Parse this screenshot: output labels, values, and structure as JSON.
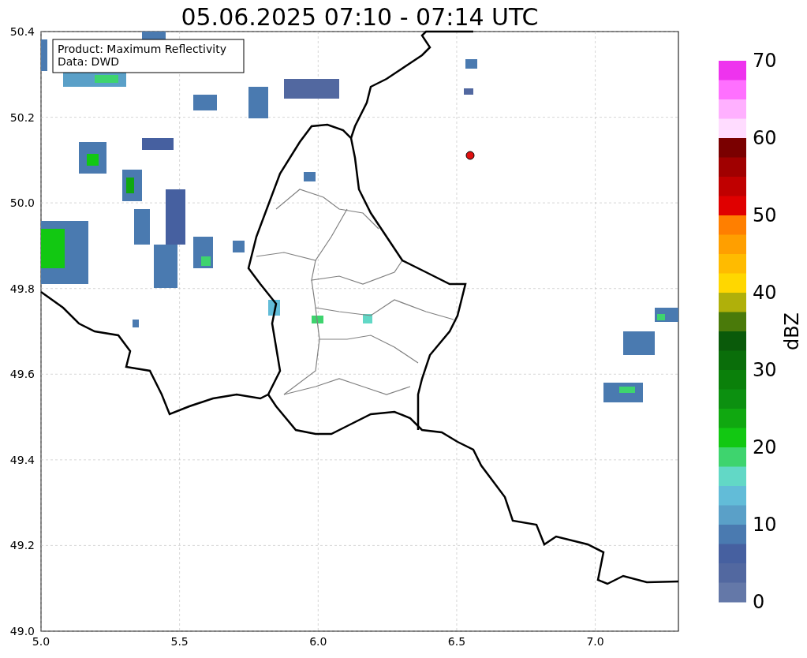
{
  "figure": {
    "title": "05.06.2025 07:10 - 07:14 UTC"
  },
  "annotation": {
    "lines": [
      "Product: Maximum Reflectivity",
      "Data: DWD"
    ]
  },
  "map": {
    "x_ticks": [
      "5.0",
      "5.5",
      "6.0",
      "6.5",
      "7.0"
    ],
    "y_ticks": [
      "50.4",
      "50.2",
      "50.0",
      "49.8",
      "49.6",
      "49.4",
      "49.2",
      "49.0"
    ]
  },
  "colorbar": {
    "label": "dBZ",
    "ticks": [
      "70",
      "60",
      "50",
      "40",
      "30",
      "20",
      "10",
      "0"
    ],
    "segments": [
      {
        "color": "#ee33ee"
      },
      {
        "color": "#ff70ff"
      },
      {
        "color": "#ffb0ff"
      },
      {
        "color": "#ffdcff"
      },
      {
        "color": "#7a0000"
      },
      {
        "color": "#a00000"
      },
      {
        "color": "#c00000"
      },
      {
        "color": "#e00000"
      },
      {
        "color": "#ff7f00"
      },
      {
        "color": "#ff9f00"
      },
      {
        "color": "#ffbb00"
      },
      {
        "color": "#ffd700"
      },
      {
        "color": "#b0b00a"
      },
      {
        "color": "#4a7a0a"
      },
      {
        "color": "#0a5a0a"
      },
      {
        "color": "#0a6e0a"
      },
      {
        "color": "#0a800a"
      },
      {
        "color": "#0c9010"
      },
      {
        "color": "#10a810"
      },
      {
        "color": "#12c812"
      },
      {
        "color": "#3ed46e"
      },
      {
        "color": "#62d8c6"
      },
      {
        "color": "#62bcd8"
      },
      {
        "color": "#5aa0c8"
      },
      {
        "color": "#4a7ab0"
      },
      {
        "color": "#4660a0"
      },
      {
        "color": "#5268a0"
      },
      {
        "color": "#6478a8"
      }
    ]
  }
}
